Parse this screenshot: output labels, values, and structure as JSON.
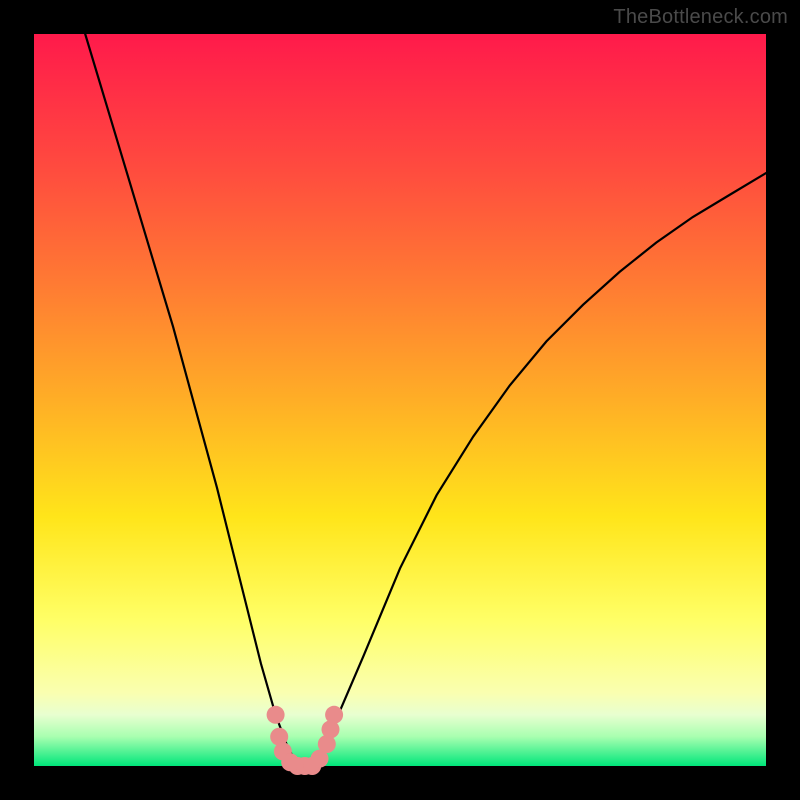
{
  "watermark": {
    "text": "TheBottleneck.com"
  },
  "chart_data": {
    "type": "line",
    "title": "",
    "xlabel": "",
    "ylabel": "",
    "xlim": [
      0,
      100
    ],
    "ylim": [
      0,
      100
    ],
    "series": [
      {
        "name": "bottleneck-curve",
        "x": [
          7,
          10,
          13,
          16,
          19,
          22,
          25,
          27,
          29,
          31,
          33,
          34.5,
          36,
          38,
          40,
          42,
          45,
          50,
          55,
          60,
          65,
          70,
          75,
          80,
          85,
          90,
          95,
          100
        ],
        "values": [
          100,
          90,
          80,
          70,
          60,
          49,
          38,
          30,
          22,
          14,
          7,
          3,
          0,
          0,
          3,
          8,
          15,
          27,
          37,
          45,
          52,
          58,
          63,
          67.5,
          71.5,
          75,
          78,
          81
        ]
      }
    ],
    "markers": {
      "name": "highlight-segment",
      "color": "#e98b8b",
      "x": [
        33,
        33.5,
        34,
        35,
        36,
        37,
        38,
        39,
        40,
        40.5,
        41
      ],
      "values": [
        7,
        4,
        2,
        0.5,
        0,
        0,
        0,
        1,
        3,
        5,
        7
      ]
    }
  }
}
